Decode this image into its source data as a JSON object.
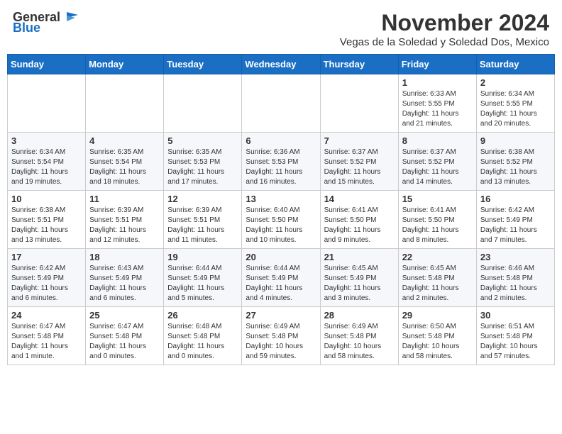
{
  "header": {
    "logo_general": "General",
    "logo_blue": "Blue",
    "month_title": "November 2024",
    "subtitle": "Vegas de la Soledad y Soledad Dos, Mexico"
  },
  "days_of_week": [
    "Sunday",
    "Monday",
    "Tuesday",
    "Wednesday",
    "Thursday",
    "Friday",
    "Saturday"
  ],
  "weeks": [
    [
      {
        "day": "",
        "info": ""
      },
      {
        "day": "",
        "info": ""
      },
      {
        "day": "",
        "info": ""
      },
      {
        "day": "",
        "info": ""
      },
      {
        "day": "",
        "info": ""
      },
      {
        "day": "1",
        "info": "Sunrise: 6:33 AM\nSunset: 5:55 PM\nDaylight: 11 hours\nand 21 minutes."
      },
      {
        "day": "2",
        "info": "Sunrise: 6:34 AM\nSunset: 5:55 PM\nDaylight: 11 hours\nand 20 minutes."
      }
    ],
    [
      {
        "day": "3",
        "info": "Sunrise: 6:34 AM\nSunset: 5:54 PM\nDaylight: 11 hours\nand 19 minutes."
      },
      {
        "day": "4",
        "info": "Sunrise: 6:35 AM\nSunset: 5:54 PM\nDaylight: 11 hours\nand 18 minutes."
      },
      {
        "day": "5",
        "info": "Sunrise: 6:35 AM\nSunset: 5:53 PM\nDaylight: 11 hours\nand 17 minutes."
      },
      {
        "day": "6",
        "info": "Sunrise: 6:36 AM\nSunset: 5:53 PM\nDaylight: 11 hours\nand 16 minutes."
      },
      {
        "day": "7",
        "info": "Sunrise: 6:37 AM\nSunset: 5:52 PM\nDaylight: 11 hours\nand 15 minutes."
      },
      {
        "day": "8",
        "info": "Sunrise: 6:37 AM\nSunset: 5:52 PM\nDaylight: 11 hours\nand 14 minutes."
      },
      {
        "day": "9",
        "info": "Sunrise: 6:38 AM\nSunset: 5:52 PM\nDaylight: 11 hours\nand 13 minutes."
      }
    ],
    [
      {
        "day": "10",
        "info": "Sunrise: 6:38 AM\nSunset: 5:51 PM\nDaylight: 11 hours\nand 13 minutes."
      },
      {
        "day": "11",
        "info": "Sunrise: 6:39 AM\nSunset: 5:51 PM\nDaylight: 11 hours\nand 12 minutes."
      },
      {
        "day": "12",
        "info": "Sunrise: 6:39 AM\nSunset: 5:51 PM\nDaylight: 11 hours\nand 11 minutes."
      },
      {
        "day": "13",
        "info": "Sunrise: 6:40 AM\nSunset: 5:50 PM\nDaylight: 11 hours\nand 10 minutes."
      },
      {
        "day": "14",
        "info": "Sunrise: 6:41 AM\nSunset: 5:50 PM\nDaylight: 11 hours\nand 9 minutes."
      },
      {
        "day": "15",
        "info": "Sunrise: 6:41 AM\nSunset: 5:50 PM\nDaylight: 11 hours\nand 8 minutes."
      },
      {
        "day": "16",
        "info": "Sunrise: 6:42 AM\nSunset: 5:49 PM\nDaylight: 11 hours\nand 7 minutes."
      }
    ],
    [
      {
        "day": "17",
        "info": "Sunrise: 6:42 AM\nSunset: 5:49 PM\nDaylight: 11 hours\nand 6 minutes."
      },
      {
        "day": "18",
        "info": "Sunrise: 6:43 AM\nSunset: 5:49 PM\nDaylight: 11 hours\nand 6 minutes."
      },
      {
        "day": "19",
        "info": "Sunrise: 6:44 AM\nSunset: 5:49 PM\nDaylight: 11 hours\nand 5 minutes."
      },
      {
        "day": "20",
        "info": "Sunrise: 6:44 AM\nSunset: 5:49 PM\nDaylight: 11 hours\nand 4 minutes."
      },
      {
        "day": "21",
        "info": "Sunrise: 6:45 AM\nSunset: 5:49 PM\nDaylight: 11 hours\nand 3 minutes."
      },
      {
        "day": "22",
        "info": "Sunrise: 6:45 AM\nSunset: 5:48 PM\nDaylight: 11 hours\nand 2 minutes."
      },
      {
        "day": "23",
        "info": "Sunrise: 6:46 AM\nSunset: 5:48 PM\nDaylight: 11 hours\nand 2 minutes."
      }
    ],
    [
      {
        "day": "24",
        "info": "Sunrise: 6:47 AM\nSunset: 5:48 PM\nDaylight: 11 hours\nand 1 minute."
      },
      {
        "day": "25",
        "info": "Sunrise: 6:47 AM\nSunset: 5:48 PM\nDaylight: 11 hours\nand 0 minutes."
      },
      {
        "day": "26",
        "info": "Sunrise: 6:48 AM\nSunset: 5:48 PM\nDaylight: 11 hours\nand 0 minutes."
      },
      {
        "day": "27",
        "info": "Sunrise: 6:49 AM\nSunset: 5:48 PM\nDaylight: 10 hours\nand 59 minutes."
      },
      {
        "day": "28",
        "info": "Sunrise: 6:49 AM\nSunset: 5:48 PM\nDaylight: 10 hours\nand 58 minutes."
      },
      {
        "day": "29",
        "info": "Sunrise: 6:50 AM\nSunset: 5:48 PM\nDaylight: 10 hours\nand 58 minutes."
      },
      {
        "day": "30",
        "info": "Sunrise: 6:51 AM\nSunset: 5:48 PM\nDaylight: 10 hours\nand 57 minutes."
      }
    ]
  ]
}
